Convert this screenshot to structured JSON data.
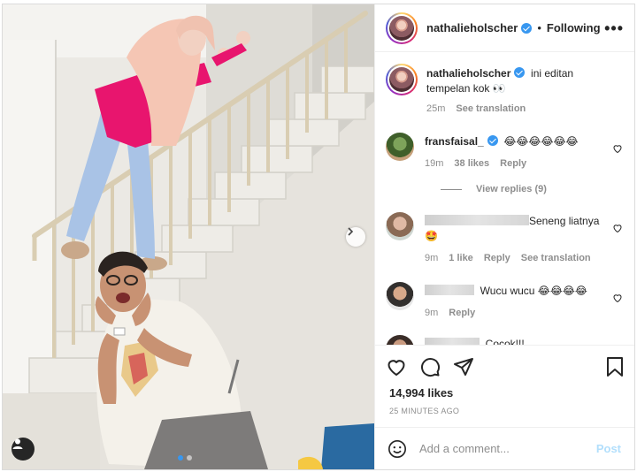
{
  "post": {
    "username": "nathalieholscher",
    "follow_separator": "•",
    "following_label": "Following",
    "more_icon": "•••",
    "caption": "ini editan tempelan kok 👀",
    "caption_time": "25m",
    "see_translation": "See translation"
  },
  "comments": [
    {
      "username": "fransfaisal_",
      "text": "😂😂😂😂😂😂",
      "time": "19m",
      "likes": "38 likes",
      "reply": "Reply",
      "view_replies": "View replies (9)"
    },
    {
      "text": "Seneng liatnya🤩",
      "time": "9m",
      "likes": "1 like",
      "reply": "Reply",
      "see_translation": "See translation"
    },
    {
      "text": "Wucu wucu 😂😂😂😂",
      "time": "9m",
      "reply": "Reply"
    },
    {
      "text": "Cocok!!!"
    }
  ],
  "stats": {
    "likes": "14,994 likes",
    "posted_ago": "25 MINUTES AGO"
  },
  "composer": {
    "placeholder": "Add a comment...",
    "post_label": "Post"
  },
  "colors": {
    "accent": "#3897f0",
    "post_disabled": "#b2dffc",
    "muted_text": "#8e8e8e",
    "cardigan": "#f5c6b4",
    "top_pink": "#e8156e"
  },
  "icons": [
    "heart-icon",
    "comment-icon",
    "share-icon",
    "bookmark-icon",
    "emoji-icon",
    "verified-icon",
    "chevron-right-icon",
    "user-tag-icon"
  ]
}
